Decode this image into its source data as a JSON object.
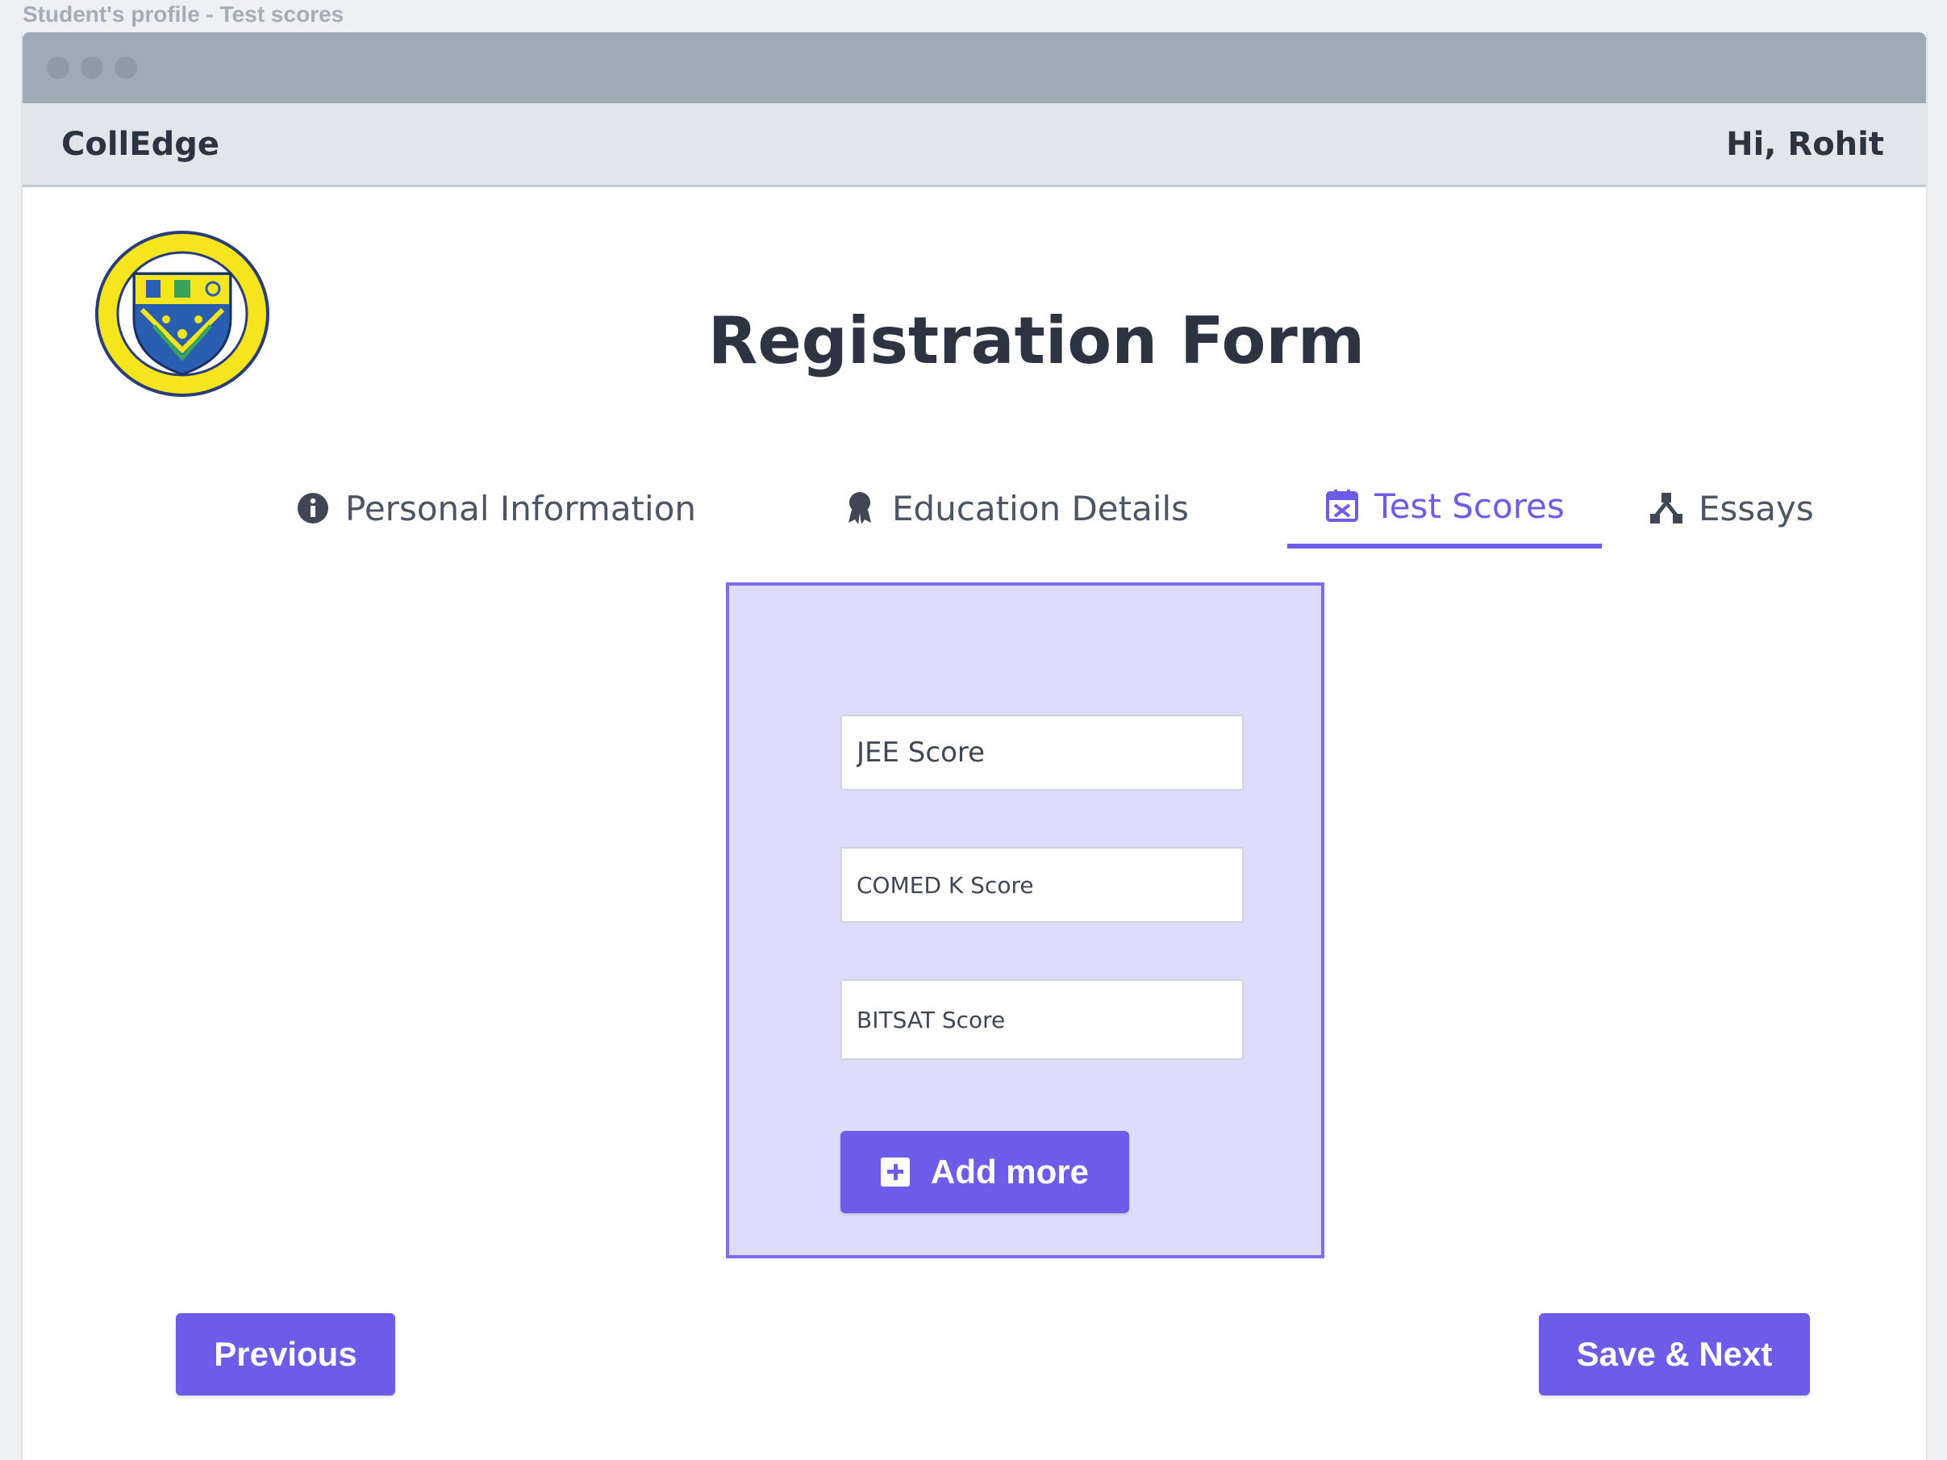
{
  "page_caption": "Student's profile - Test scores",
  "header": {
    "brand": "CollEdge",
    "greeting": "Hi, Rohit"
  },
  "form": {
    "title": "Registration Form"
  },
  "tabs": [
    {
      "label": "Personal Information",
      "icon": "info-circle-icon",
      "active": false
    },
    {
      "label": "Education Details",
      "icon": "award-icon",
      "active": false
    },
    {
      "label": "Test Scores",
      "icon": "calendar-icon",
      "active": true
    },
    {
      "label": "Essays",
      "icon": "sitemap-icon",
      "active": false
    }
  ],
  "test_scores": {
    "jee_placeholder": "JEE Score",
    "comedk_placeholder": "COMED K Score",
    "bitsat_placeholder": "BITSAT Score",
    "add_more_label": "Add more"
  },
  "actions": {
    "previous_label": "Previous",
    "save_next_label": "Save & Next"
  },
  "colors": {
    "accent": "#6c5ce7",
    "panel_bg": "#dedcfb",
    "titlebar": "#9eabb7"
  }
}
